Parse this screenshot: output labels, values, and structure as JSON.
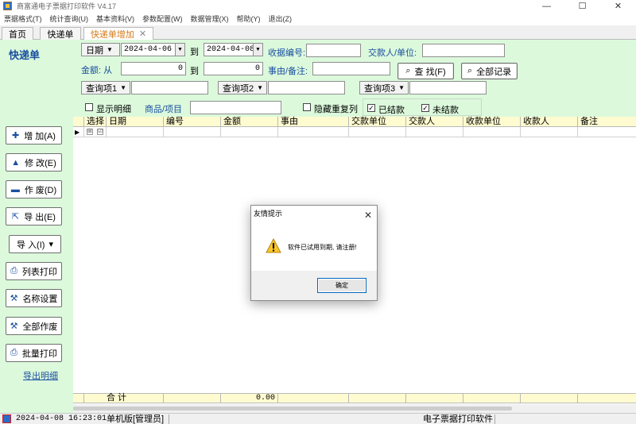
{
  "window": {
    "title": "商富通电子票据打印软件 V4.17",
    "minimize": "—",
    "maximize": "☐",
    "close": "✕"
  },
  "menu": [
    "票据格式(T)",
    "统计查询(U)",
    "基本资料(V)",
    "参数配置(W)",
    "数据管理(X)",
    "帮助(Y)",
    "退出(Z)"
  ],
  "tabs": [
    {
      "label": "首页"
    },
    {
      "label": "快递单"
    },
    {
      "label": "快递单增加"
    }
  ],
  "tab_close": "✕",
  "filter": {
    "heading": "快递单",
    "date_field": "日期",
    "date_from": "2024-04-06",
    "date_to": "2024-04-08",
    "to": "到",
    "receipt_no_label": "收据编号:",
    "receipt_no_value": "",
    "payer_label": "交款人/单位:",
    "payer_value": "",
    "amount_label": "金额: 从",
    "amount_from": "0",
    "amount_to": "0",
    "reason_label": "事由/备注:",
    "reason_value": "",
    "search_button": "查 找(F)",
    "all_records_button": "全部记录",
    "query1": "查询项1",
    "query2": "查询项2",
    "query3": "查询项3",
    "show_detail_label": "显示明细",
    "show_detail_checked": false,
    "product_label": "商品/项目",
    "hide_dup_label": "隐藏重复列",
    "hide_dup_checked": false,
    "settled_label": "已结款",
    "settled_checked": true,
    "unsettled_label": "未结款",
    "unsettled_checked": true
  },
  "sidebar": {
    "buttons": [
      {
        "label": "增 加(A)",
        "icon": "plus-icon",
        "glyph": "✚"
      },
      {
        "label": "修 改(E)",
        "icon": "triangle-up-icon",
        "glyph": "▲"
      },
      {
        "label": "作 废(D)",
        "icon": "minus-icon",
        "glyph": "▬"
      },
      {
        "label": "导 出(E)",
        "icon": "export-icon",
        "glyph": "⇱"
      },
      {
        "label": "导 入(I)",
        "icon": "import-dropdown-icon",
        "glyph": "▾"
      },
      {
        "label": "列表打印",
        "icon": "printer-icon",
        "glyph": "⎙"
      },
      {
        "label": "名称设置",
        "icon": "name-settings-icon",
        "glyph": "⚒"
      },
      {
        "label": "全部作废",
        "icon": "void-all-icon",
        "glyph": "⚒"
      },
      {
        "label": "批量打印",
        "icon": "batch-print-icon",
        "glyph": "⎙"
      }
    ],
    "export_detail_link": "导出明细"
  },
  "grid": {
    "columns": [
      "选择",
      "日期",
      "编号",
      "金额",
      "事由",
      "交款单位",
      "交款人",
      "收款单位",
      "收款人",
      "备注"
    ],
    "row_indicator": "▶",
    "expand_glyph": "⊞",
    "check_glyph": "☑",
    "footer_label": "合  计",
    "footer_amount": "0.00"
  },
  "status": {
    "datetime": "2024-04-08 16:23:01",
    "mode": "单机版[管理员]",
    "app_name": "电子票据打印软件"
  },
  "dialog": {
    "title": "友情提示",
    "message": "软件已试用到期, 请注册!",
    "ok_button": "确定",
    "close": "✕"
  },
  "colors": {
    "panel_bg": "#dcf9dc",
    "label_blue": "#1a4fa0",
    "grid_header_bg": "#fffbd0",
    "active_tab_text": "#d67a1a",
    "warning_yellow": "#f7c52c"
  }
}
